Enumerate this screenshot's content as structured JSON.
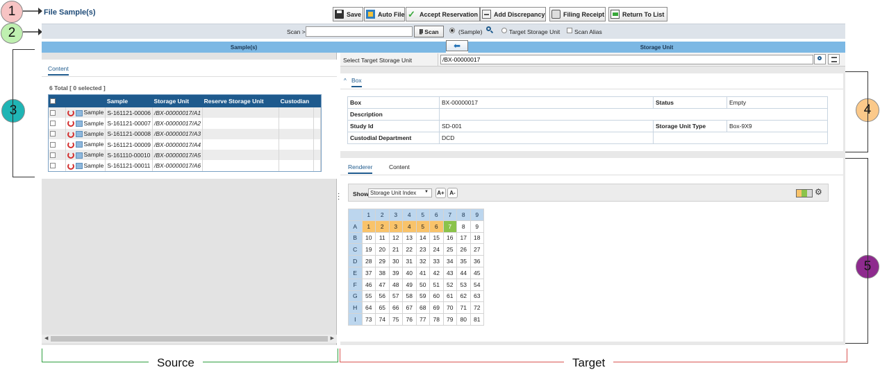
{
  "page_title": "File Sample(s)",
  "toolbar": {
    "save": "Save",
    "auto_file": "Auto File",
    "accept_reservation": "Accept Reservation",
    "add_discrepancy": "Add Discrepancy",
    "filing_receipt": "Filing Receipt",
    "return_to_list": "Return To List"
  },
  "scanbar": {
    "label": "Scan >",
    "input_value": "",
    "scan_button": "Scan",
    "radio_sample": "(Sample)",
    "radio_target": "Target Storage Unit",
    "checkbox_alias": "Scan Alias"
  },
  "source": {
    "header": "Sample(s)",
    "tab_content": "Content",
    "total_prefix": "6 Total [",
    "selected_count": "0",
    "total_suffix": "selected ]",
    "columns": [
      "Sample",
      "Storage Unit",
      "Reserve Storage Unit",
      "Custodian"
    ],
    "rows": [
      {
        "type": "Sample",
        "id": "S-161121-00006",
        "unit": "/BX-00000017/A1"
      },
      {
        "type": "Sample",
        "id": "S-161121-00007",
        "unit": "/BX-00000017/A2"
      },
      {
        "type": "Sample",
        "id": "S-161121-00008",
        "unit": "/BX-00000017/A3"
      },
      {
        "type": "Sample",
        "id": "S-161121-00009",
        "unit": "/BX-00000017/A4"
      },
      {
        "type": "Sample",
        "id": "S-161110-00010",
        "unit": "/BX-00000017/A5"
      },
      {
        "type": "Sample",
        "id": "S-161121-00011",
        "unit": "/BX-00000017/A6"
      }
    ]
  },
  "target": {
    "header": "Storage Unit",
    "select_label": "Select Target Storage Unit",
    "select_value": "/BX-00000017",
    "section_box": "Box",
    "info": {
      "box_label": "Box",
      "box_value": "BX-00000017",
      "status_label": "Status",
      "status_value": "Empty",
      "description_label": "Description",
      "description_value": "",
      "study_label": "Study Id",
      "study_value": "SD-001",
      "type_label": "Storage Unit Type",
      "type_value": "Box-9X9",
      "dept_label": "Custodial Department",
      "dept_value": "DCD"
    },
    "tab_renderer": "Renderer",
    "tab_content": "Content",
    "show_label": "Show",
    "show_select": "Storage Unit Index",
    "font_up": "A+",
    "font_down": "A-",
    "grid": {
      "col_headers": [
        "1",
        "2",
        "3",
        "4",
        "5",
        "6",
        "7",
        "8",
        "9"
      ],
      "row_headers": [
        "A",
        "B",
        "C",
        "D",
        "E",
        "F",
        "G",
        "H",
        "I"
      ],
      "occupied_cells": [
        1,
        2,
        3,
        4,
        5,
        6
      ],
      "current_cell": 7,
      "occupied_color": "#f9c36a",
      "current_color": "#8bc34a"
    }
  },
  "callouts": [
    "1",
    "2",
    "3",
    "4",
    "5"
  ],
  "labels": {
    "source": "Source",
    "target": "Target"
  },
  "colors": {
    "header_blue": "#7cb8e4",
    "table_header": "#1e5a8d",
    "source_line": "#2e9e3e",
    "target_line": "#d9534f"
  }
}
